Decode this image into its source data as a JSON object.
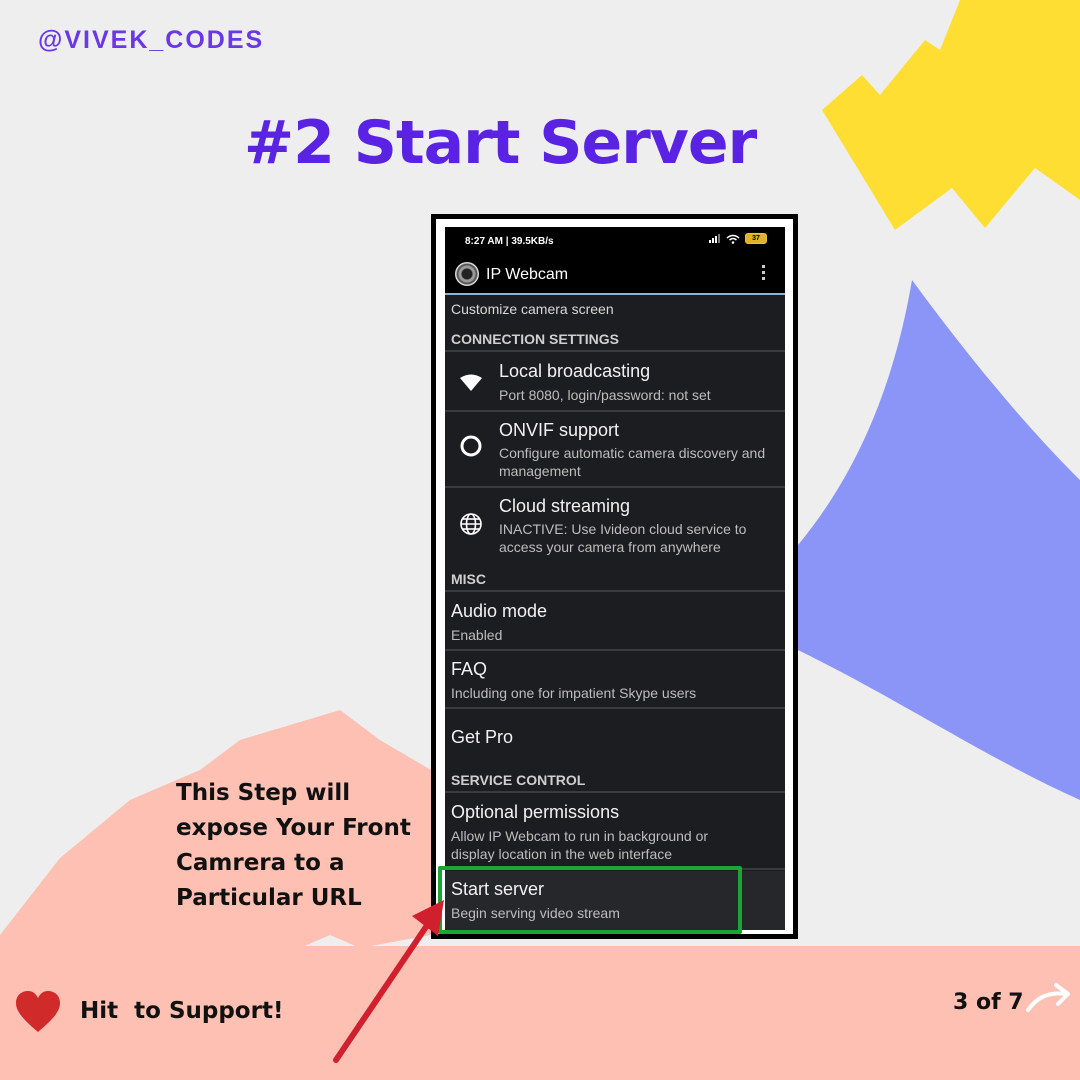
{
  "header": {
    "handle": "@VIVEK_CODES",
    "title": "#2 Start Server"
  },
  "caption": {
    "text": "This Step will expose Your Front Camrera to a Particular URL"
  },
  "footer": {
    "support_text": "Hit  to Support!",
    "pager": "3 of 7"
  },
  "colors": {
    "accent": "#5a22e2",
    "yellow": "#ffde33",
    "blue": "#8b95f8",
    "salmon": "#fdc0b3",
    "highlight": "#1aa535",
    "arrow": "#d0202e",
    "heart": "#d02a2a"
  },
  "phone": {
    "status": {
      "left": "8:27 AM | 39.5KB/s",
      "battery": "37"
    },
    "app_title": "IP Webcam",
    "rows": {
      "customize": "Customize camera screen",
      "connection_header": "CONNECTION SETTINGS",
      "local": {
        "title": "Local broadcasting",
        "sub": "Port 8080, login/password: not set",
        "icon": "wifi-icon"
      },
      "onvif": {
        "title": "ONVIF support",
        "sub": "Configure automatic camera discovery and management",
        "icon": "ring-icon"
      },
      "cloud": {
        "title": "Cloud streaming",
        "sub": "INACTIVE: Use Ivideon cloud service to access your camera from anywhere",
        "icon": "globe-icon"
      },
      "misc_header": "MISC",
      "audio": {
        "title": "Audio mode",
        "sub": "Enabled"
      },
      "faq": {
        "title": "FAQ",
        "sub": "Including one for impatient Skype users"
      },
      "getpro": {
        "title": "Get Pro"
      },
      "service_header": "SERVICE CONTROL",
      "permissions": {
        "title": "Optional permissions",
        "sub": "Allow IP Webcam to run in background or display location in the web interface"
      },
      "start": {
        "title": "Start server",
        "sub": "Begin serving video stream"
      }
    }
  }
}
